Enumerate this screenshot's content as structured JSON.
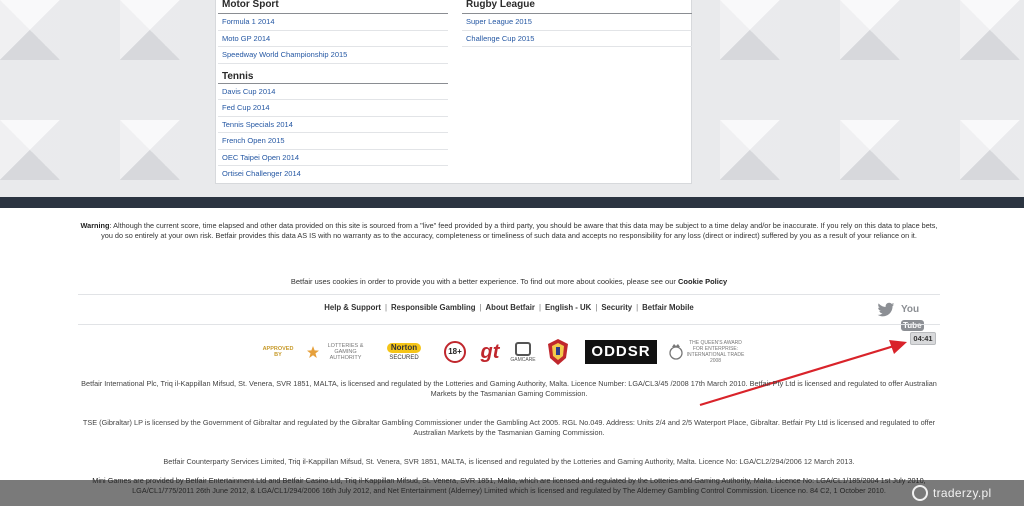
{
  "sports_panel": {
    "left_column": {
      "sections": [
        {
          "title": "Motor Sport",
          "links": [
            "Formula 1 2014",
            "Moto GP 2014",
            "Speedway World Championship 2015"
          ]
        },
        {
          "title": "Tennis",
          "links": [
            "Davis Cup 2014",
            "Fed Cup 2014",
            "Tennis Specials 2014",
            "French Open 2015",
            "OEC Taipei Open 2014",
            "Ortisei Challenger 2014"
          ]
        }
      ]
    },
    "right_column": {
      "sections": [
        {
          "title": "Rugby League",
          "links": [
            "Super League 2015",
            "Challenge Cup 2015"
          ]
        }
      ]
    }
  },
  "footer": {
    "warning_label": "Warning",
    "warning_text": ": Although the current score, time elapsed and other data provided on this site is sourced from a \"live\" feed provided by a third party, you should be aware that this data may be subject to a time delay and/or be inaccurate. If you rely on this data to place bets, you do so entirely at your own risk. Betfair provides this data AS IS with no warranty as to the accuracy, completeness or timeliness of such data and accepts no responsibility for any loss (direct or indirect) suffered by you as a result of your reliance on it.",
    "cookie_text": "Betfair uses cookies in order to provide you with a better experience. To find out more about cookies, please see our ",
    "cookie_link": "Cookie Policy",
    "nav_links": [
      "Help & Support",
      "Responsible Gambling",
      "About Betfair",
      "English - UK",
      "Security",
      "Betfair Mobile"
    ],
    "social": {
      "twitter_icon": "twitter-icon",
      "youtube_you": "You",
      "youtube_tube": "Tube"
    },
    "logos": {
      "approved_by": "APPROVED BY",
      "lga": "LOTTERIES & GAMING AUTHORITY",
      "norton_title": "Norton",
      "norton_sub": "SECURED",
      "age": "18+",
      "gt": "gt",
      "gamcare": "GAMCARE",
      "oddsr": "ODDSR",
      "queens_award": "THE QUEEN'S AWARD FOR ENTERPRISE: INTERNATIONAL TRADE 2008"
    },
    "timer": "04:41",
    "legal_paragraphs": [
      "Betfair International Plc, Triq il-Kappillan Mifsud, St. Venera, SVR 1851, MALTA, is licensed and regulated by the Lotteries and Gaming Authority, Malta. Licence Number: LGA/CL3/45 /2008 17th March 2010. Betfair Pty Ltd is licensed and regulated to offer Australian Markets by the Tasmanian Gaming Commission.",
      "TSE (Gibraltar) LP is licensed by the Government of Gibraltar and regulated by the Gibraltar Gambling Commissioner under the Gambling Act 2005. RGL No.049. Address: Units 2/4 and 2/5 Waterport Place, Gibraltar. Betfair Pty Ltd is licensed and regulated to offer Australian Markets by the Tasmanian Gaming Commission.",
      "Betfair Counterparty Services Limited, Triq il-Kappillan Mifsud, St. Venera, SVR 1851, MALTA, is licensed and regulated by the Lotteries and Gaming Authority, Malta. Licence No: LGA/CL2/294/2006 12 March 2013.",
      "Mini Games are provided by Betfair Entertainment Ltd and Betfair Casino Ltd, Triq il-Kappillan Mifsud, St. Venera, SVR 1851, Malta, which are licensed and regulated by the Lotteries and Gaming Authority, Malta. Licence No: LGA/CL1/185/2004 1st July 2010, LGA/CL1/775/2011 26th June 2012, & LGA/CL1/294/2006 16th July 2012, and Net Entertainment (Alderney) Limited which is licensed and regulated by The Alderney Gambling Control Commission. Licence no. 84 C2, 1 October 2010."
    ]
  },
  "watermark": {
    "text": "traderzy.pl"
  },
  "colors": {
    "link": "#2457a3",
    "dark_strip": "#2b3441",
    "arrow": "#d9232a"
  }
}
